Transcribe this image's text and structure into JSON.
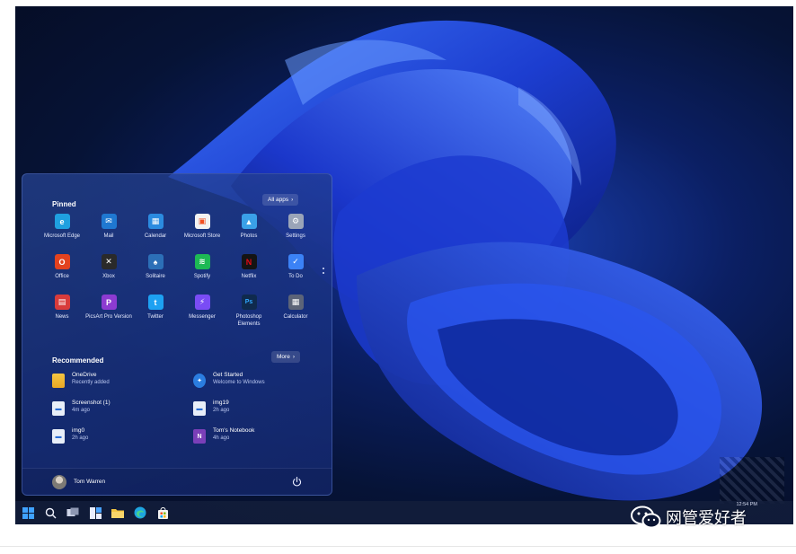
{
  "start_menu": {
    "pinned_title": "Pinned",
    "all_apps_label": "All apps",
    "pinned_apps": [
      {
        "label": "Microsoft Edge",
        "icon": "edge-icon",
        "color": "#1fa0e0"
      },
      {
        "label": "Mail",
        "icon": "mail-icon",
        "color": "#1f78d1"
      },
      {
        "label": "Calendar",
        "icon": "calendar-icon",
        "color": "#2b8be0"
      },
      {
        "label": "Microsoft Store",
        "icon": "store-icon",
        "color": "#f2f2f2"
      },
      {
        "label": "Photos",
        "icon": "photos-icon",
        "color": "#3aa0e8"
      },
      {
        "label": "Settings",
        "icon": "settings-icon",
        "color": "#9aa4b8"
      },
      {
        "label": "Office",
        "icon": "office-icon",
        "color": "#e3421f"
      },
      {
        "label": "Xbox",
        "icon": "xbox-icon",
        "color": "#2a2a2a"
      },
      {
        "label": "Solitaire",
        "icon": "solitaire-icon",
        "color": "#2c6fb7"
      },
      {
        "label": "Spotify",
        "icon": "spotify-icon",
        "color": "#1db954"
      },
      {
        "label": "Netflix",
        "icon": "netflix-icon",
        "color": "#141414"
      },
      {
        "label": "To Do",
        "icon": "todo-icon",
        "color": "#3b82f6"
      },
      {
        "label": "News",
        "icon": "news-icon",
        "color": "#d83b3b"
      },
      {
        "label": "PicsArt Pro Version",
        "icon": "picsart-icon",
        "color": "#8c3bd1"
      },
      {
        "label": "Twitter",
        "icon": "twitter-icon",
        "color": "#1da1f2"
      },
      {
        "label": "Messenger",
        "icon": "messenger-icon",
        "color": "#7a4cf5"
      },
      {
        "label": "Photoshop Elements",
        "icon": "photoshop-icon",
        "color": "#0f2a4d"
      },
      {
        "label": "Calculator",
        "icon": "calculator-icon",
        "color": "#5c6478"
      }
    ],
    "recommended_title": "Recommended",
    "more_label": "More",
    "recommended": [
      {
        "name": "OneDrive",
        "sub": "Recently added",
        "icon": "folder-icon",
        "color": "#f2c14e"
      },
      {
        "name": "Get Started",
        "sub": "Welcome to Windows",
        "icon": "get-started-icon",
        "color": "#2b7de0"
      },
      {
        "name": "Screenshot (1)",
        "sub": "4m ago",
        "icon": "image-file-icon",
        "color": "#e8eef8"
      },
      {
        "name": "img19",
        "sub": "2h ago",
        "icon": "image-file-icon",
        "color": "#e8eef8"
      },
      {
        "name": "img0",
        "sub": "2h ago",
        "icon": "image-file-icon",
        "color": "#e8eef8"
      },
      {
        "name": "Tom's Notebook",
        "sub": "4h ago",
        "icon": "onenote-icon",
        "color": "#7a3fb8"
      }
    ],
    "user_name": "Tom Warren"
  },
  "taskbar": {
    "icons": [
      "windows-start-icon",
      "search-icon",
      "task-view-icon",
      "widgets-icon",
      "file-explorer-icon",
      "edge-icon",
      "store-icon"
    ],
    "time": "12:54 PM"
  },
  "watermark": {
    "text": "网管爱好者"
  }
}
